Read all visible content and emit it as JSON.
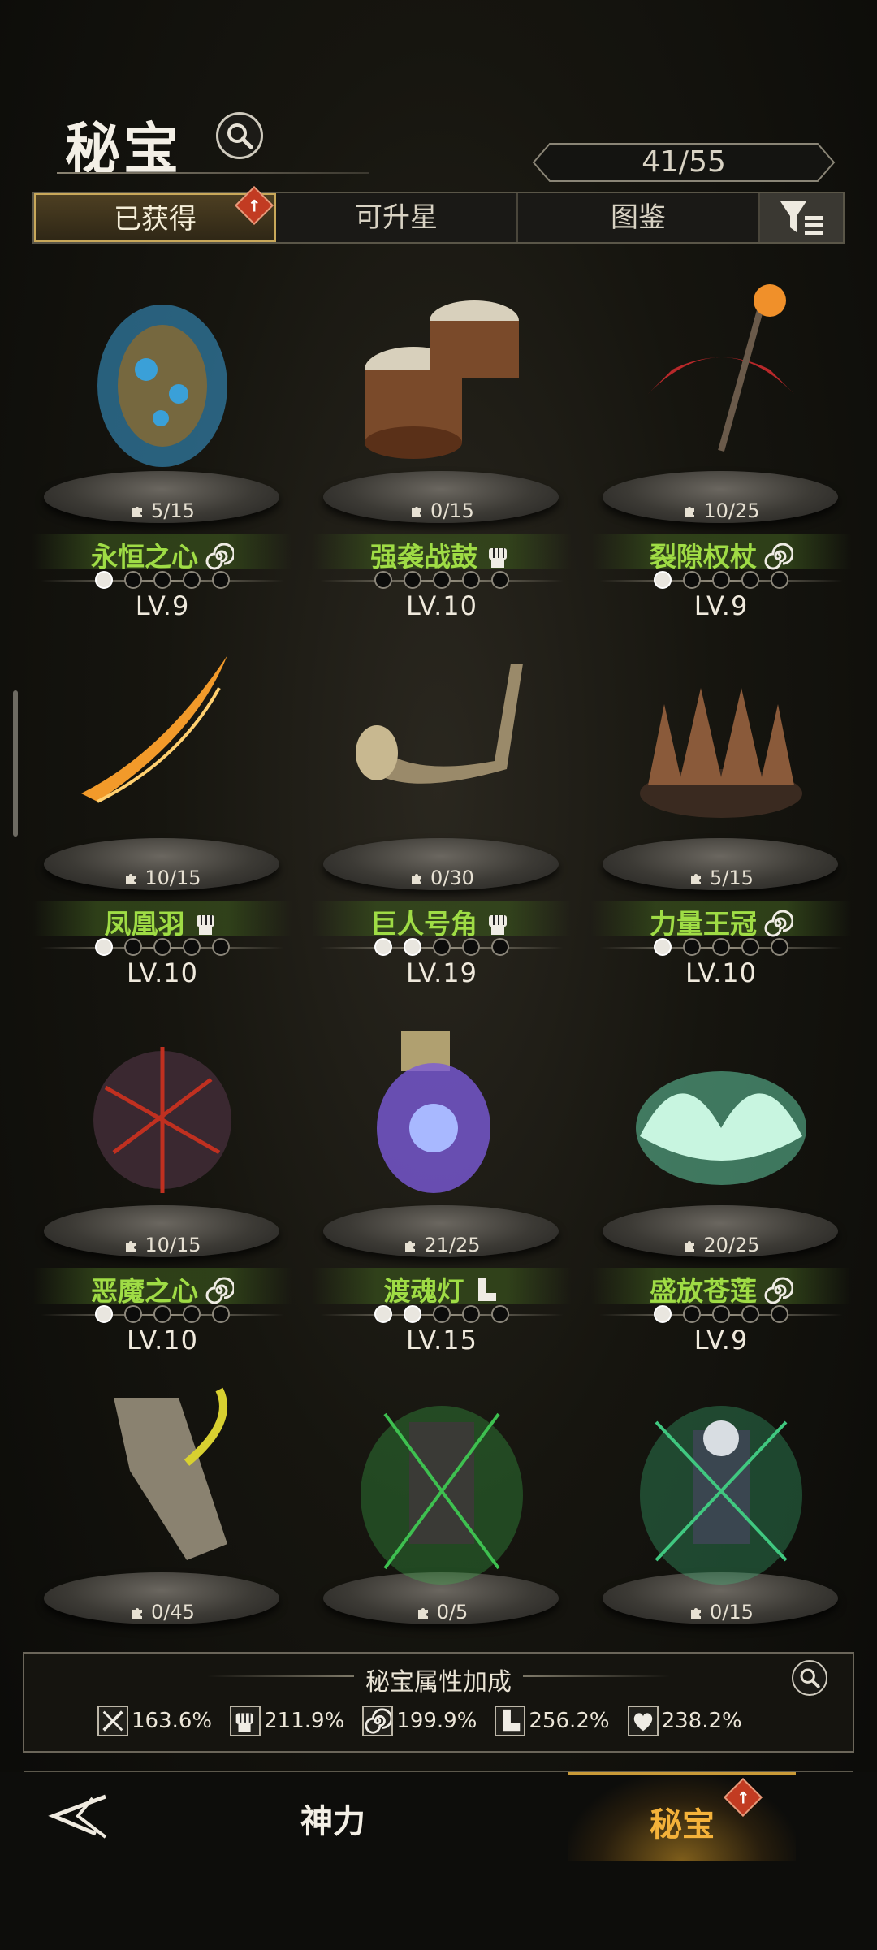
{
  "header": {
    "title": "秘宝",
    "counter": "41/55"
  },
  "tabs": [
    {
      "label": "已获得",
      "active": true,
      "badge": "↑"
    },
    {
      "label": "可升星",
      "active": false
    },
    {
      "label": "图鉴",
      "active": false
    }
  ],
  "items": [
    {
      "name": "永恒之心",
      "progress": "5/15",
      "level": "LV.9",
      "stars": 1,
      "type_icon": "spiral-icon",
      "art_color": "#3aa0d8"
    },
    {
      "name": "强袭战鼓",
      "progress": "0/15",
      "level": "LV.10",
      "stars": 0,
      "type_icon": "fist-icon",
      "art_color": "#c9a06a"
    },
    {
      "name": "裂隙权杖",
      "progress": "10/25",
      "level": "LV.9",
      "stars": 1,
      "type_icon": "spiral-icon",
      "art_color": "#b8282a"
    },
    {
      "name": "凤凰羽",
      "progress": "10/15",
      "level": "LV.10",
      "stars": 1,
      "type_icon": "fist-icon",
      "art_color": "#f29a2a"
    },
    {
      "name": "巨人号角",
      "progress": "0/30",
      "level": "LV.19",
      "stars": 2,
      "type_icon": "fist-icon",
      "art_color": "#9a8a6a"
    },
    {
      "name": "力量王冠",
      "progress": "5/15",
      "level": "LV.10",
      "stars": 1,
      "type_icon": "spiral-icon",
      "art_color": "#8a5a3a"
    },
    {
      "name": "恶魔之心",
      "progress": "10/15",
      "level": "LV.10",
      "stars": 1,
      "type_icon": "spiral-icon",
      "art_color": "#c03020"
    },
    {
      "name": "渡魂灯",
      "progress": "21/25",
      "level": "LV.15",
      "stars": 2,
      "type_icon": "boot-icon",
      "art_color": "#7a5ad8"
    },
    {
      "name": "盛放苍莲",
      "progress": "20/25",
      "level": "LV.9",
      "stars": 1,
      "type_icon": "spiral-icon",
      "art_color": "#6adcb0"
    },
    {
      "name": "",
      "progress": "0/45",
      "level": "",
      "stars": -1,
      "type_icon": "",
      "art_color": "#d8d030"
    },
    {
      "name": "",
      "progress": "0/5",
      "level": "",
      "stars": -1,
      "type_icon": "",
      "art_color": "#3ec050"
    },
    {
      "name": "",
      "progress": "0/15",
      "level": "",
      "stars": -1,
      "type_icon": "",
      "art_color": "#40c880"
    }
  ],
  "bonus": {
    "title": "秘宝属性加成",
    "stats": [
      {
        "icon": "sword-icon",
        "value": "163.6%"
      },
      {
        "icon": "fist-icon",
        "value": "211.9%"
      },
      {
        "icon": "spiral-icon",
        "value": "199.9%"
      },
      {
        "icon": "boot-icon",
        "value": "256.2%"
      },
      {
        "icon": "heart-icon",
        "value": "238.2%"
      }
    ]
  },
  "nav": {
    "left_label": "神力",
    "right_label": "秘宝",
    "badge": "↑"
  }
}
